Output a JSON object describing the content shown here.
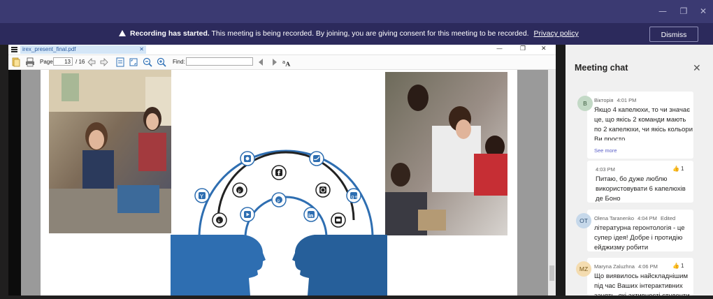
{
  "window": {
    "minimize_glyph": "—",
    "restore_glyph": "❐",
    "close_glyph": "✕"
  },
  "banner": {
    "bold_text": "Recording has started.",
    "text": "This meeting is being recorded. By joining, you are giving consent for this meeting to be recorded.",
    "link": "Privacy policy",
    "dismiss_label": "Dismiss"
  },
  "viewer": {
    "tab_title": "irex_present_final.pdf",
    "page_label": "Page:",
    "page_current": "13",
    "page_total": "/ 16",
    "find_label": "Find:",
    "find_value": ""
  },
  "chat": {
    "title": "Meeting chat",
    "messages": [
      {
        "initials": "В",
        "author": "Вікторія",
        "time": "4:01 PM",
        "text": "Якщо 4 капелюхи, то чи значає це, що якісь 2 команди мають по 2 капелюхи, чи якісь кольори Ви просто",
        "see_more": "See more"
      },
      {
        "time": "4:03 PM",
        "likes": "1",
        "text": "Питаю, бо дуже люблю використовувати 6 капелюхів де Боно"
      },
      {
        "initials": "OT",
        "author": "Olena Taranenko",
        "time": "4:04 PM",
        "edited": "Edited",
        "text": "літературна геронтологія - це супер ідея! Добре і протидію ейджизму робити"
      },
      {
        "initials": "MZ",
        "author": "Maryna Zaluzhna",
        "time": "4:06 PM",
        "likes": "1",
        "text": "Що виявилось найскладнішим під час Ваших інтерактивних занять, які активності студенти"
      }
    ]
  },
  "colors": {
    "title_bar": "#3b3a72",
    "banner": "#2c2a5c",
    "accent": "#5b5fc7",
    "head_blue": "#2e6eb1"
  }
}
